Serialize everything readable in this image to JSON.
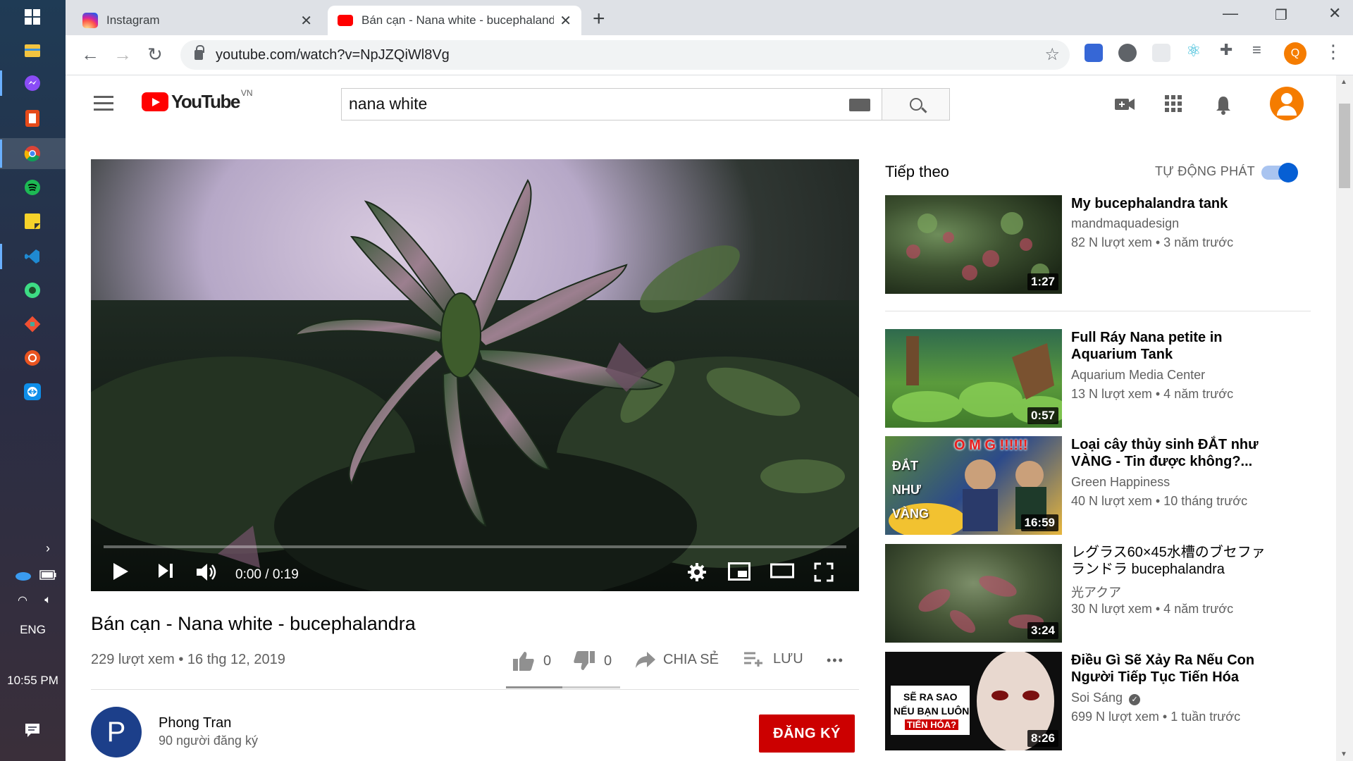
{
  "taskbar": {
    "language": "ENG",
    "time": "10:55 PM"
  },
  "browser": {
    "tabs": [
      {
        "label": "Instagram",
        "close": "✕"
      },
      {
        "label": "Bán cạn - Nana white - bucephalandra",
        "close": "✕"
      }
    ],
    "new_tab": "+",
    "url": "youtube.com/watch?v=NpJZQiWl8Vg",
    "profile_letter": "Q"
  },
  "youtube": {
    "logo_text": "YouTube",
    "country_code": "VN",
    "search_value": "nana white",
    "video": {
      "time": "0:00 / 0:19",
      "progress": 0.0,
      "title": "Bán cạn - Nana white - bucephalandra",
      "meta": "229 lượt xem • 16 thg 12, 2019",
      "likes": "0",
      "dislikes": "0",
      "share_label": "CHIA SẺ",
      "save_label": "LƯU",
      "more_label": "•••"
    },
    "channel": {
      "initial": "P",
      "name": "Phong Tran",
      "subs": "90 người đăng ký",
      "subscribe_label": "ĐĂNG KÝ"
    },
    "sidebar": {
      "up_next": "Tiếp theo",
      "autoplay_label": "TỰ ĐỘNG PHÁT",
      "autoplay_on": true,
      "items": [
        {
          "title": "My bucephalandra tank",
          "channel": "mandmaquadesign",
          "meta": "82 N lượt xem • 3 năm trước",
          "duration": "1:27"
        },
        {
          "title": "Full Ráy Nana petite in Aquarium Tank",
          "channel": "Aquarium Media Center",
          "meta": "13 N lượt xem • 4 năm trước",
          "duration": "0:57"
        },
        {
          "title": "Loại cây thủy sinh ĐẮT như VÀNG - Tin được không?...",
          "channel": "Green Happiness",
          "meta": "40 N lượt xem • 10 tháng trước",
          "duration": "16:59",
          "thumb_text": [
            "O M G !!!!!!",
            "ĐẮT",
            "NHƯ",
            "VÀNG"
          ]
        },
        {
          "title": "レグラス60×45水槽のブセファランドラ bucephalandra",
          "channel": "光アクア",
          "meta": "30 N lượt xem • 4 năm trước",
          "duration": "3:24"
        },
        {
          "title": "Điều Gì Sẽ Xảy Ra Nếu Con Người Tiếp Tục Tiến Hóa",
          "channel": "Soi Sáng",
          "meta": "699 N lượt xem • 1 tuần trước",
          "duration": "8:26",
          "thumb_text": [
            "SẼ RA SAO",
            "NẾU BẠN LUÔN",
            "TIẾN HÓA?"
          ]
        }
      ]
    }
  }
}
